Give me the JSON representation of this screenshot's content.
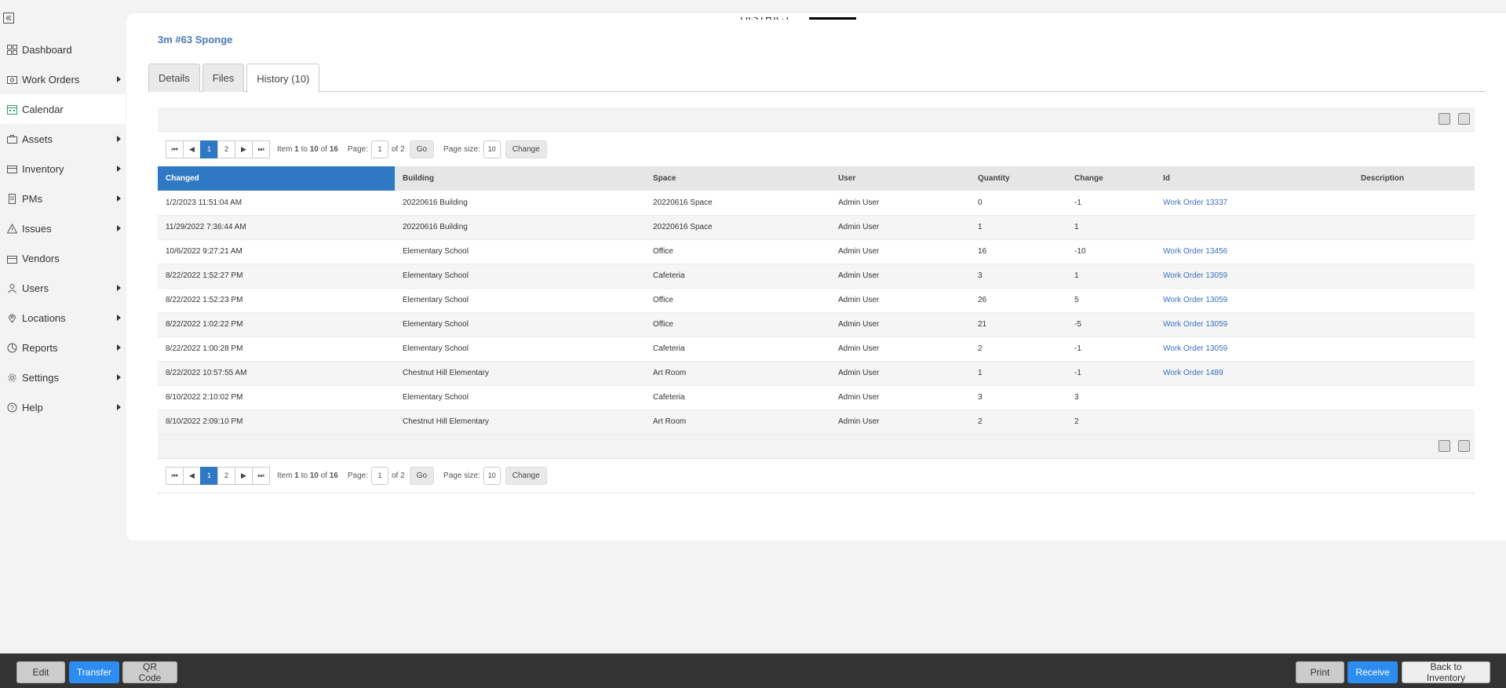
{
  "sidebar": {
    "items": [
      {
        "label": "Dashboard",
        "icon": "dashboard-icon",
        "caret": false
      },
      {
        "label": "Work Orders",
        "icon": "wrench-icon",
        "caret": true
      },
      {
        "label": "Calendar",
        "icon": "calendar-icon",
        "caret": false
      },
      {
        "label": "Assets",
        "icon": "briefcase-icon",
        "caret": true
      },
      {
        "label": "Inventory",
        "icon": "box-icon",
        "caret": true
      },
      {
        "label": "PMs",
        "icon": "document-icon",
        "caret": true
      },
      {
        "label": "Issues",
        "icon": "warning-icon",
        "caret": true
      },
      {
        "label": "Vendors",
        "icon": "store-icon",
        "caret": false
      },
      {
        "label": "Users",
        "icon": "user-icon",
        "caret": true
      },
      {
        "label": "Locations",
        "icon": "pin-icon",
        "caret": true
      },
      {
        "label": "Reports",
        "icon": "chart-icon",
        "caret": true
      },
      {
        "label": "Settings",
        "icon": "gear-icon",
        "caret": true
      },
      {
        "label": "Help",
        "icon": "help-icon",
        "caret": true
      }
    ],
    "active": "Calendar"
  },
  "item": {
    "title": "3m #63 Sponge"
  },
  "tabs": [
    {
      "label": "Details"
    },
    {
      "label": "Files"
    },
    {
      "label": "History (10)"
    }
  ],
  "pager": {
    "pages": [
      "1",
      "2"
    ],
    "current": "1",
    "item_label": "Item",
    "from": "1",
    "to_label": "to",
    "to": "10",
    "of_label": "of",
    "total": "16",
    "page_label": "Page:",
    "page_value": "1",
    "of_pages": "of 2",
    "go_label": "Go",
    "size_label": "Page size:",
    "size_value": "10",
    "change_label": "Change"
  },
  "table": {
    "columns": [
      "Changed",
      "Building",
      "Space",
      "User",
      "Quantity",
      "Change",
      "Id",
      "Description"
    ],
    "rows": [
      [
        "1/2/2023 11:51:04 AM",
        "20220616 Building",
        "20220616 Space",
        "Admin User",
        "0",
        "-1",
        "Work Order 13337",
        ""
      ],
      [
        "11/29/2022 7:36:44 AM",
        "20220616 Building",
        "20220616 Space",
        "Admin User",
        "1",
        "1",
        "",
        ""
      ],
      [
        "10/6/2022 9:27:21 AM",
        "Elementary School",
        "Office",
        "Admin User",
        "16",
        "-10",
        "Work Order 13456",
        ""
      ],
      [
        "8/22/2022 1:52:27 PM",
        "Elementary School",
        "Cafeteria",
        "Admin User",
        "3",
        "1",
        "Work Order 13059",
        ""
      ],
      [
        "8/22/2022 1:52:23 PM",
        "Elementary School",
        "Office",
        "Admin User",
        "26",
        "5",
        "Work Order 13059",
        ""
      ],
      [
        "8/22/2022 1:02:22 PM",
        "Elementary School",
        "Office",
        "Admin User",
        "21",
        "-5",
        "Work Order 13059",
        ""
      ],
      [
        "8/22/2022 1:00:28 PM",
        "Elementary School",
        "Cafeteria",
        "Admin User",
        "2",
        "-1",
        "Work Order 13059",
        ""
      ],
      [
        "8/22/2022 10:57:55 AM",
        "Chestnut Hill Elementary",
        "Art Room",
        "Admin User",
        "1",
        "-1",
        "Work Order 1489",
        ""
      ],
      [
        "8/10/2022 2:10:02 PM",
        "Elementary School",
        "Cafeteria",
        "Admin User",
        "3",
        "3",
        "",
        ""
      ],
      [
        "8/10/2022 2:09:10 PM",
        "Chestnut Hill Elementary",
        "Art Room",
        "Admin User",
        "2",
        "2",
        "",
        ""
      ]
    ]
  },
  "bottom_bar": {
    "edit": "Edit",
    "transfer": "Transfer",
    "qr": "QR Code",
    "print": "Print",
    "receive": "Receive",
    "back": "Back to Inventory"
  },
  "colors": {
    "accent": "#2f79c4",
    "link": "#3b6fbf",
    "title": "#4a7ab5",
    "bottom_bar": "#333333",
    "primary_button": "#2d8cf0"
  }
}
